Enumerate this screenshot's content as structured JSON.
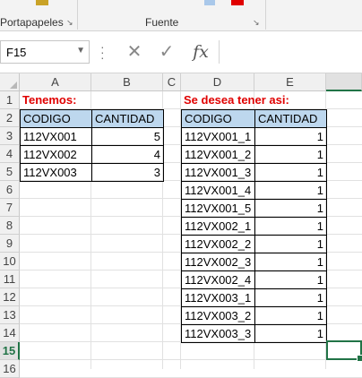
{
  "ribbon": {
    "groups": [
      {
        "label": "Portapapeles",
        "launcher": "↘"
      },
      {
        "label": "Fuente",
        "launcher": "↘"
      }
    ]
  },
  "formula_bar": {
    "name_box": "F15",
    "cancel_icon": "✕",
    "enter_icon": "✓",
    "function_icon": "fx",
    "value": ""
  },
  "sheet": {
    "columns": [
      "A",
      "B",
      "C",
      "D",
      "E"
    ],
    "rows": [
      "1",
      "2",
      "3",
      "4",
      "5",
      "6",
      "7",
      "8",
      "9",
      "10",
      "11",
      "12",
      "13",
      "14",
      "15",
      "16"
    ],
    "selected_cell": "F15",
    "left_title": "Tenemos:",
    "right_title": "Se desea tener asi:",
    "left_table": {
      "headers": [
        "CODIGO",
        "CANTIDAD"
      ],
      "rows": [
        [
          "112VX001",
          "5"
        ],
        [
          "112VX002",
          "4"
        ],
        [
          "112VX003",
          "3"
        ]
      ]
    },
    "right_table": {
      "headers": [
        "CODIGO",
        "CANTIDAD"
      ],
      "rows": [
        [
          "112VX001_1",
          "1"
        ],
        [
          "112VX001_2",
          "1"
        ],
        [
          "112VX001_3",
          "1"
        ],
        [
          "112VX001_4",
          "1"
        ],
        [
          "112VX001_5",
          "1"
        ],
        [
          "112VX002_1",
          "1"
        ],
        [
          "112VX002_2",
          "1"
        ],
        [
          "112VX002_3",
          "1"
        ],
        [
          "112VX002_4",
          "1"
        ],
        [
          "112VX003_1",
          "1"
        ],
        [
          "112VX003_2",
          "1"
        ],
        [
          "112VX003_3",
          "1"
        ]
      ]
    }
  },
  "colors": {
    "accent": "#217346",
    "title_red": "#e00000",
    "header_fill": "#bdd7ee"
  }
}
